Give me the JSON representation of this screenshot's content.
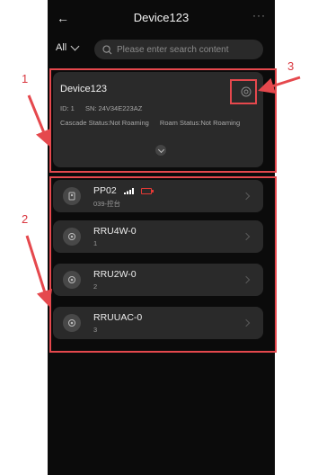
{
  "header": {
    "back_icon": "back-arrow-icon",
    "title": "Device123",
    "more_icon": "more-dots-icon"
  },
  "filter": {
    "selected": "All"
  },
  "search": {
    "placeholder": "Please enter search content"
  },
  "device_card": {
    "name": "Device123",
    "id_text": "ID: 1",
    "sn_text": "SN: 24V34E223AZ",
    "cascade_text": "Cascade Status:Not Roaming",
    "roam_text": "Roam Status:Not Roaming"
  },
  "items": [
    {
      "name": "PP02",
      "sub": "039-控台",
      "icon": "device-icon",
      "signal": true,
      "battery": "low"
    },
    {
      "name": "RRU4W-0",
      "sub": "1",
      "icon": "circle-dot-icon"
    },
    {
      "name": "RRU2W-0",
      "sub": "2",
      "icon": "circle-dot-icon"
    },
    {
      "name": "RRUUAC-0",
      "sub": "3",
      "icon": "circle-dot-icon"
    }
  ],
  "annotations": {
    "label_1": "1",
    "label_2": "2",
    "label_3": "3"
  },
  "colors": {
    "background": "#0b0b0b",
    "card": "#2a2a2a",
    "annotation": "#e5484d"
  }
}
